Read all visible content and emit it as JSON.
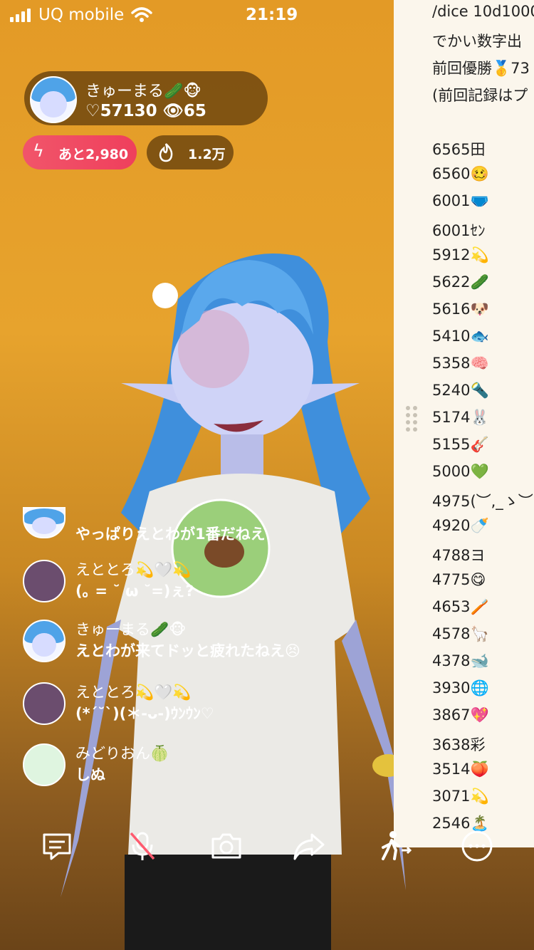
{
  "status_bar": {
    "carrier": "UQ mobile",
    "time": "21:19"
  },
  "host": {
    "name": "きゅーまる🥒🐵",
    "hearts": "♡57130",
    "viewers": "👁65"
  },
  "badges": {
    "remaining": "あと2,980",
    "heat": "1.2万"
  },
  "comments": [
    {
      "name": "",
      "text": "やっぱりえとわが1番だねえ"
    },
    {
      "name": "えととろ💫🤍💫",
      "text": "(｡ = ˘ ω ˘=)ぇ?"
    },
    {
      "name": "きゅーまる🥒🐵",
      "text": "えとわが来てドッと疲れたねえ😣"
    },
    {
      "name": "えととろ💫🤍💫",
      "text": "(*´˘`)(＊-ᴗ-)ｳﾝｳﾝ♡"
    },
    {
      "name": "みどりおん🍈",
      "text": "しぬ"
    }
  ],
  "panel": {
    "header_lines": [
      "/dice 10d1000",
      "でかい数字出",
      "前回優勝🥇73",
      "(前回記録はプ"
    ],
    "scores": [
      "6565田",
      "6560🥴",
      "6001🩲",
      "6001ｾﾝ",
      "5912💫",
      "5622🥒",
      "5616🐶",
      "5410🐟",
      "5358🧠",
      "5240🔦",
      "5174🐰",
      "5155🎸",
      "5000💚",
      "4975(︶,_ゝ︶",
      "4920🍼",
      "4788ヨ",
      "4775😋",
      "4653🪥",
      "4578🦙",
      "4378🐋",
      "3930🌐",
      "3867💖",
      "3638彩",
      "3514🍑",
      "3071💫",
      "2546🏝️"
    ]
  },
  "bottom_bar": {
    "icons": [
      "comment-icon",
      "mic-off-icon",
      "camera-icon",
      "share-icon",
      "walk-icon",
      "more-icon"
    ]
  }
}
